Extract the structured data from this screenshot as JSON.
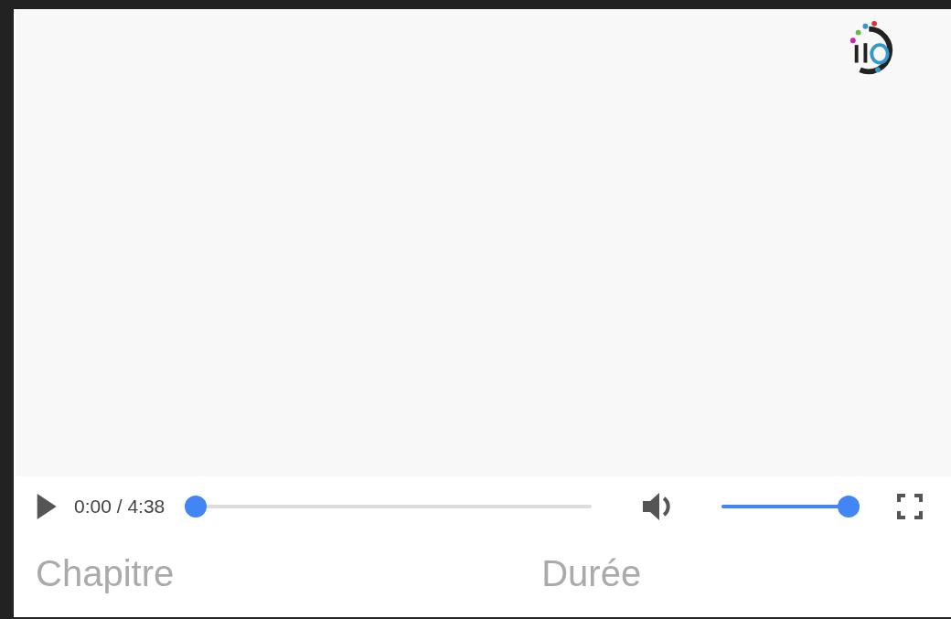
{
  "player": {
    "playing": false,
    "time": "0:00 / 4:38",
    "progress": {
      "level": 0
    },
    "volume": {
      "level": 0.92,
      "muted": false
    }
  },
  "chapters": {
    "columns": [
      "Chapitre",
      "Durée"
    ]
  }
}
